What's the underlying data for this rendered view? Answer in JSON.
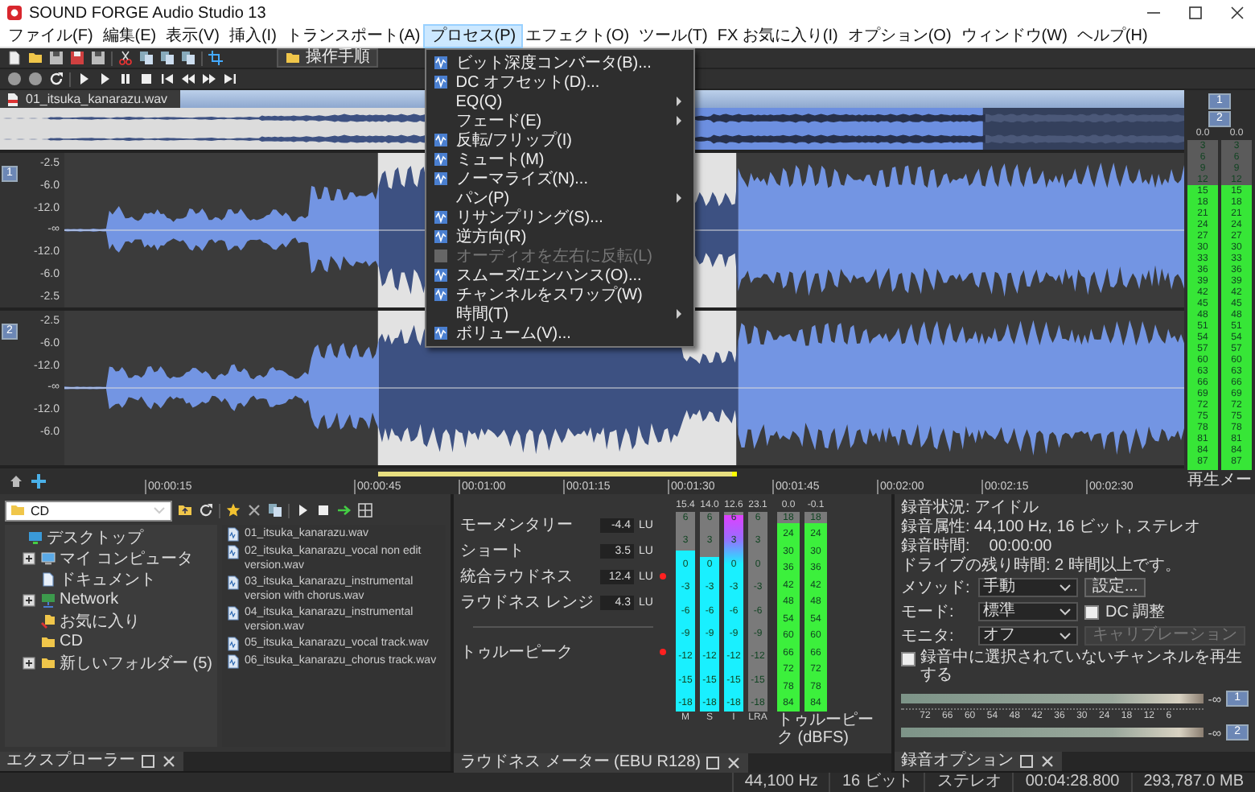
{
  "window": {
    "title": "SOUND FORGE Audio Studio 13"
  },
  "menu_bar": [
    {
      "label": "ファイル(F)",
      "selected": false
    },
    {
      "label": "編集(E)",
      "selected": false
    },
    {
      "label": "表示(V)",
      "selected": false
    },
    {
      "label": "挿入(I)",
      "selected": false
    },
    {
      "label": "トランスポート(A)",
      "selected": false
    },
    {
      "label": "プロセス(P)",
      "selected": true
    },
    {
      "label": "エフェクト(O)",
      "selected": false
    },
    {
      "label": "ツール(T)",
      "selected": false
    },
    {
      "label": "FX お気に入り(I)",
      "selected": false
    },
    {
      "label": "オプション(O)",
      "selected": false
    },
    {
      "label": "ウィンドウ(W)",
      "selected": false
    },
    {
      "label": "ヘルプ(H)",
      "selected": false
    }
  ],
  "process_menu": [
    {
      "label": "ビット深度コンバータ(B)...",
      "kind": "command",
      "disabled": false
    },
    {
      "label": "DC オフセット(D)...",
      "kind": "command",
      "disabled": false
    },
    {
      "label": "EQ(Q)",
      "kind": "submenu",
      "disabled": false
    },
    {
      "label": "フェード(E)",
      "kind": "submenu",
      "disabled": false
    },
    {
      "label": "反転/フリップ(I)",
      "kind": "command",
      "disabled": false
    },
    {
      "label": "ミュート(M)",
      "kind": "command",
      "disabled": false
    },
    {
      "label": "ノーマライズ(N)...",
      "kind": "command",
      "disabled": false
    },
    {
      "label": "パン(P)",
      "kind": "submenu",
      "disabled": false
    },
    {
      "label": "リサンプリング(S)...",
      "kind": "command",
      "disabled": false
    },
    {
      "label": "逆方向(R)",
      "kind": "command",
      "disabled": false
    },
    {
      "label": "オーディオを左右に反転(L)",
      "kind": "command",
      "disabled": true
    },
    {
      "label": "スムーズ/エンハンス(O)...",
      "kind": "command",
      "disabled": false
    },
    {
      "label": "チャンネルをスワップ(W)",
      "kind": "command",
      "disabled": false
    },
    {
      "label": "時間(T)",
      "kind": "submenu",
      "disabled": false
    },
    {
      "label": "ボリューム(V)...",
      "kind": "command",
      "disabled": false
    }
  ],
  "toolbar": {
    "workflow_button": "操作手順"
  },
  "data_window": {
    "title": "01_itsuka_kanarazu.wav",
    "ruler": [
      "00:00:15",
      "00:00:45",
      "00:01:00",
      "00:01:15",
      "00:01:30",
      "00:01:45",
      "00:02:00",
      "00:02:15",
      "00:02:30"
    ],
    "channels": [
      {
        "number": "1",
        "scale": [
          "-2.5",
          "-6.0",
          "-12.0",
          "-∞",
          "-12.0",
          "-6.0",
          "-2.5"
        ]
      },
      {
        "number": "2",
        "scale": [
          "-2.5",
          "-6.0",
          "-12.0",
          "-∞",
          "-12.0",
          "-6.0"
        ]
      }
    ]
  },
  "playback_meter": {
    "buttons": [
      "1",
      "2"
    ],
    "label": "再生メー",
    "channels": [
      {
        "peak": "0.0",
        "level": 0.862,
        "scale": [
          "3",
          "6",
          "9",
          "12",
          "15",
          "18",
          "21",
          "24",
          "27",
          "30",
          "33",
          "36",
          "39",
          "42",
          "45",
          "48",
          "51",
          "54",
          "57",
          "60",
          "63",
          "66",
          "69",
          "72",
          "75",
          "78",
          "81",
          "84",
          "87"
        ]
      },
      {
        "peak": "0.0",
        "level": 0.862,
        "scale": [
          "3",
          "6",
          "9",
          "12",
          "15",
          "18",
          "21",
          "24",
          "27",
          "30",
          "33",
          "36",
          "39",
          "42",
          "45",
          "48",
          "51",
          "54",
          "57",
          "60",
          "63",
          "66",
          "69",
          "72",
          "75",
          "78",
          "81",
          "84",
          "87"
        ]
      }
    ]
  },
  "explorer": {
    "path": "CD",
    "tab": "エクスプローラー",
    "tree": [
      {
        "label": "デスクトップ",
        "kind": "desktop",
        "has_children": false,
        "children": [
          {
            "label": "マイ コンピュータ",
            "kind": "computer",
            "has_children": true
          },
          {
            "label": "ドキュメント",
            "kind": "documents",
            "has_children": false
          },
          {
            "label": "Network",
            "kind": "network",
            "has_children": true
          },
          {
            "label": "お気に入り",
            "kind": "favorites",
            "has_children": false
          },
          {
            "label": "CD",
            "kind": "folder",
            "has_children": false
          },
          {
            "label": "新しいフォルダー (5)",
            "kind": "folder",
            "has_children": true
          }
        ]
      }
    ],
    "files": [
      "01_itsuka_kanarazu.wav",
      "02_itsuka_kanarazu_vocal non edit version.wav",
      "03_itsuka_kanarazu_instrumental version with chorus.wav",
      "04_itsuka_kanarazu_instrumental version.wav",
      "05_itsuka_kanarazu_vocal track.wav",
      "06_itsuka_kanarazu_chorus track.wav"
    ]
  },
  "loudness": {
    "tab": "ラウドネス メーター (EBU R128)",
    "readings": [
      {
        "label": "モーメンタリー",
        "value": "-4.4",
        "unit": "LU",
        "alert": false
      },
      {
        "label": "ショート",
        "value": "3.5",
        "unit": "LU",
        "alert": false
      },
      {
        "label": "統合ラウドネス",
        "value": "12.4",
        "unit": "LU",
        "alert": true
      },
      {
        "label": "ラウドネス レンジ",
        "value": "4.3",
        "unit": "LU",
        "alert": false
      }
    ],
    "true_peak": {
      "label": "トゥルーピーク",
      "alert": true
    },
    "meters": [
      {
        "name": "M",
        "peak": "15.4",
        "level": 0.82,
        "scale": [
          "6",
          "3",
          "0",
          "-3",
          "-6",
          "-9",
          "-12",
          "-15",
          "-18"
        ]
      },
      {
        "name": "S",
        "peak": "14.0",
        "level": 0.79,
        "scale": [
          "6",
          "3",
          "0",
          "-3",
          "-6",
          "-9",
          "-12",
          "-15",
          "-18"
        ]
      },
      {
        "name": "I",
        "peak": "12.6",
        "level": 1.0,
        "scale": [
          "6",
          "3",
          "0",
          "-3",
          "-6",
          "-9",
          "-12",
          "-15",
          "-18"
        ]
      },
      {
        "name": "LRA",
        "peak": "23.1",
        "level": 0,
        "scale": [
          "6",
          "3",
          "0",
          "-3",
          "-6",
          "-9",
          "-12",
          "-15",
          "-18"
        ]
      }
    ],
    "true_peak_meter": {
      "label": "トゥルーピーク (dBFS)",
      "channels": [
        {
          "peak": "0.0",
          "level": 0.96,
          "scale": [
            "18",
            "24",
            "30",
            "36",
            "42",
            "48",
            "54",
            "60",
            "66",
            "72",
            "78",
            "84"
          ]
        },
        {
          "peak": "-0.1",
          "level": 0.96,
          "scale": [
            "18",
            "24",
            "30",
            "36",
            "42",
            "48",
            "54",
            "60",
            "66",
            "72",
            "78",
            "84"
          ]
        }
      ]
    }
  },
  "recording": {
    "tab": "録音オプション",
    "status": "録音状況: アイドル",
    "attributes": "録音属性: 44,100 Hz, 16 ビット, ステレオ",
    "time": {
      "label": "録音時間:",
      "value": "00:00:00"
    },
    "remaining": "ドライブの残り時間: 2 時間以上です。",
    "fields": [
      {
        "label": "メソッド:",
        "value": "手動",
        "side": {
          "kind": "button",
          "label": "設定...",
          "disabled": false
        }
      },
      {
        "label": "モード:",
        "value": "標準",
        "side": {
          "kind": "checkbox",
          "label": "DC 調整",
          "checked": false
        }
      },
      {
        "label": "モニタ:",
        "value": "オフ",
        "side": {
          "kind": "button",
          "label": "キャリブレーション",
          "disabled": true
        }
      }
    ],
    "play_unselected": {
      "label": "録音中に選択されていないチャンネルを再生する",
      "checked": false
    },
    "meter": {
      "scale": [
        "72",
        "66",
        "60",
        "54",
        "48",
        "42",
        "36",
        "30",
        "24",
        "18",
        "12",
        "6"
      ],
      "channels": [
        {
          "reading": "-∞",
          "button": "1"
        },
        {
          "reading": "-∞",
          "button": "2"
        }
      ]
    }
  },
  "status_bar": [
    "44,100 Hz",
    "16 ビット",
    "ステレオ",
    "00:04:28.800",
    "293,787.0 MB"
  ]
}
